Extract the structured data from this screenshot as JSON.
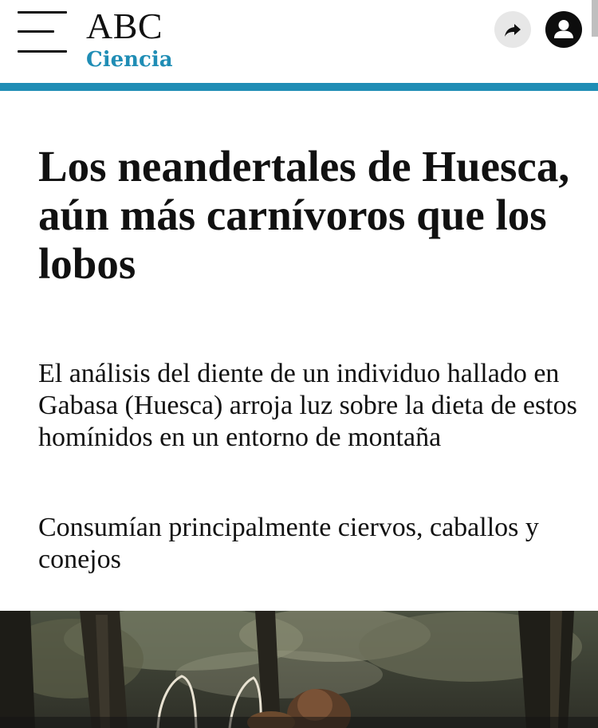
{
  "header": {
    "brand": "ABC",
    "section": "Ciencia",
    "menu_icon": "hamburger-menu-icon",
    "share_icon": "share-arrow-icon",
    "user_icon": "user-account-icon",
    "accent_color": "#1f8db5"
  },
  "article": {
    "headline": "Los neandertales de Huesca, aún más carnívoros que los lobos",
    "subheadline": "El análisis del diente de un individuo hallado en Gabasa (Huesca) arroja luz sobre la dieta de estos homínidos en un entorno de montaña",
    "highlight": "Consumían principalmente ciervos, caballos y conejos"
  }
}
